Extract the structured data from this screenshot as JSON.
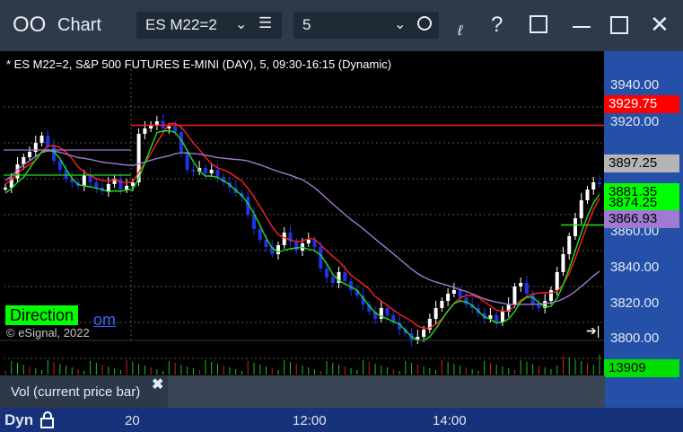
{
  "window": {
    "title": "Chart",
    "symbol_value": "ES M22=2",
    "interval_value": "5"
  },
  "chart": {
    "header_text": "* ES M22=2, S&P 500 FUTURES E-MINI (DAY), 5, 09:30-16:15 (Dynamic)",
    "copyright": "© eSignal, 2022",
    "direction_badge": "Direction",
    "direction_suffix": "om"
  },
  "price_axis": {
    "ticks": [
      "3940.00",
      "3920.00",
      "3860.00",
      "3840.00",
      "3820.00",
      "3800.00"
    ],
    "labels": {
      "red": "3929.75",
      "last": "3897.25",
      "green": "3881.35",
      "green2": "3874.25",
      "purple": "3866.93"
    }
  },
  "volume": {
    "label": "Vol (current price bar)",
    "value": "13909"
  },
  "time_axis": {
    "mode": "Dyn",
    "ticks": [
      "20",
      "12:00",
      "14:00"
    ]
  },
  "colors": {
    "titlebar": "#2e3a4a",
    "axis_bar": "#15327a",
    "up": "#ffffff",
    "down": "#1f34e8",
    "red_line": "#ff2020",
    "green_line": "#20e020",
    "purple_line": "#a07ad0"
  },
  "chart_data": {
    "type": "candlestick",
    "ylim": [
      3800,
      3950
    ],
    "x": [
      "20",
      "12:00",
      "14:00"
    ],
    "lines": [
      {
        "color": "red",
        "level": 3929.75
      },
      {
        "color": "green",
        "level": 3874.25
      },
      {
        "color": "purple",
        "level": 3866.93
      }
    ]
  }
}
